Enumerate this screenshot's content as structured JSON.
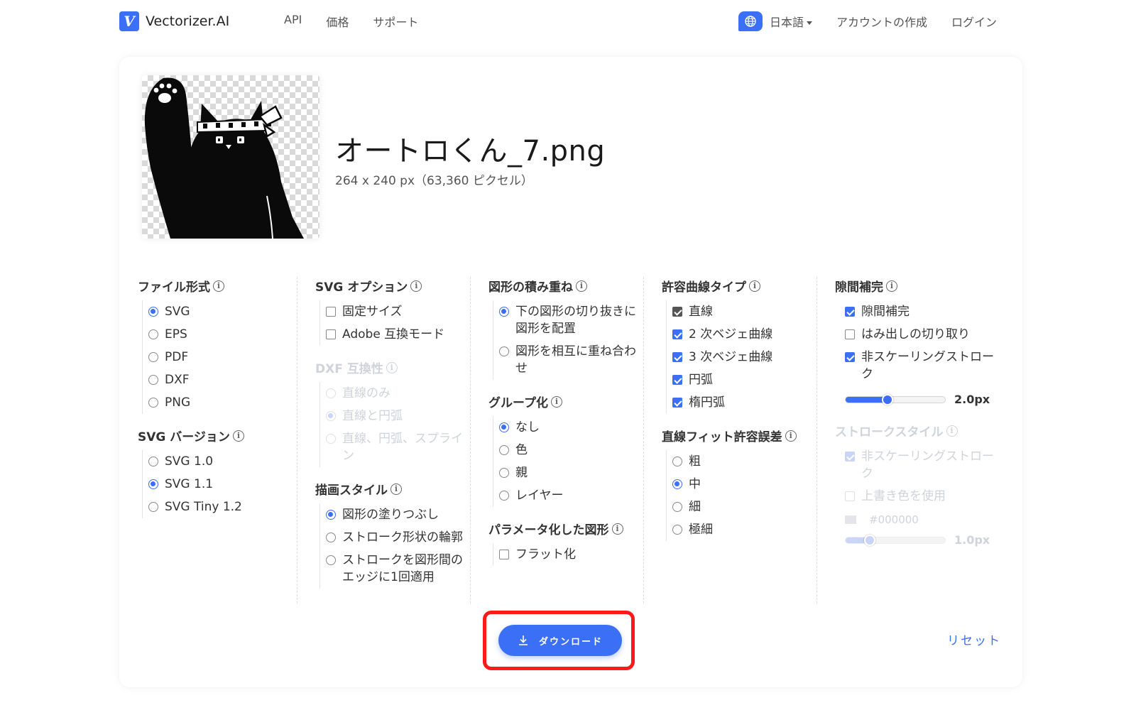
{
  "brand": {
    "name": "Vectorizer.AI",
    "logo_letter": "V",
    "accent": "#3b6ff5"
  },
  "nav": {
    "links": [
      "API",
      "価格",
      "サポート"
    ],
    "language": "日本語",
    "create_account": "アカウントの作成",
    "login": "ログイン"
  },
  "file": {
    "name": "オートロくん_7.png",
    "info": "264 x 240 px（63,360 ピクセル）"
  },
  "options": {
    "file_format": {
      "title": "ファイル形式",
      "items": [
        {
          "label": "SVG",
          "selected": true
        },
        {
          "label": "EPS",
          "selected": false
        },
        {
          "label": "PDF",
          "selected": false
        },
        {
          "label": "DXF",
          "selected": false
        },
        {
          "label": "PNG",
          "selected": false
        }
      ]
    },
    "svg_version": {
      "title": "SVG バージョン",
      "items": [
        {
          "label": "SVG 1.0",
          "selected": false
        },
        {
          "label": "SVG 1.1",
          "selected": true
        },
        {
          "label": "SVG Tiny 1.2",
          "selected": false
        }
      ]
    },
    "svg_options": {
      "title": "SVG オプション",
      "items": [
        {
          "label": "固定サイズ",
          "checked": false
        },
        {
          "label": "Adobe 互換モード",
          "checked": false
        }
      ]
    },
    "dxf_compat": {
      "title": "DXF 互換性",
      "disabled": true,
      "items": [
        {
          "label": "直線のみ",
          "selected": false
        },
        {
          "label": "直線と円弧",
          "selected": true
        },
        {
          "label": "直線、円弧、スプライン",
          "selected": false
        }
      ]
    },
    "draw_style": {
      "title": "描画スタイル",
      "items": [
        {
          "label": "図形の塗りつぶし",
          "selected": true
        },
        {
          "label": "ストローク形状の輪郭",
          "selected": false
        },
        {
          "label": "ストロークを図形間のエッジに1回適用",
          "selected": false
        }
      ]
    },
    "stacking": {
      "title": "図形の積み重ね",
      "items": [
        {
          "label": "下の図形の切り抜きに図形を配置",
          "selected": true
        },
        {
          "label": "図形を相互に重ね合わせ",
          "selected": false
        }
      ]
    },
    "grouping": {
      "title": "グループ化",
      "items": [
        {
          "label": "なし",
          "selected": true
        },
        {
          "label": "色",
          "selected": false
        },
        {
          "label": "親",
          "selected": false
        },
        {
          "label": "レイヤー",
          "selected": false
        }
      ]
    },
    "parametric": {
      "title": "パラメータ化した図形",
      "items": [
        {
          "label": "フラット化",
          "checked": false
        }
      ]
    },
    "curve_types": {
      "title": "許容曲線タイプ",
      "items": [
        {
          "label": "直線",
          "checked": true,
          "locked": true
        },
        {
          "label": "2 次ベジェ曲線",
          "checked": true
        },
        {
          "label": "3 次ベジェ曲線",
          "checked": true
        },
        {
          "label": "円弧",
          "checked": true
        },
        {
          "label": "楕円弧",
          "checked": true
        }
      ]
    },
    "line_fit": {
      "title": "直線フィット許容誤差",
      "items": [
        {
          "label": "粗",
          "selected": false
        },
        {
          "label": "中",
          "selected": true
        },
        {
          "label": "細",
          "selected": false
        },
        {
          "label": "極細",
          "selected": false
        }
      ]
    },
    "gap_filler": {
      "title": "隙間補完",
      "items": [
        {
          "label": "隙間補完",
          "checked": true
        },
        {
          "label": "はみ出しの切り取り",
          "checked": false
        },
        {
          "label": "非スケーリングストローク",
          "checked": true
        }
      ],
      "slider_value": "2.0px",
      "slider_fraction": 0.42
    },
    "stroke_style": {
      "title": "ストロークスタイル",
      "disabled": true,
      "items": [
        {
          "label": "非スケーリングストローク",
          "checked": true
        },
        {
          "label": "上書き色を使用",
          "checked": false
        }
      ],
      "color": "#000000",
      "slider_value": "1.0px",
      "slider_fraction": 0.24
    }
  },
  "actions": {
    "download": "ダウンロード",
    "reset": "リセット"
  }
}
